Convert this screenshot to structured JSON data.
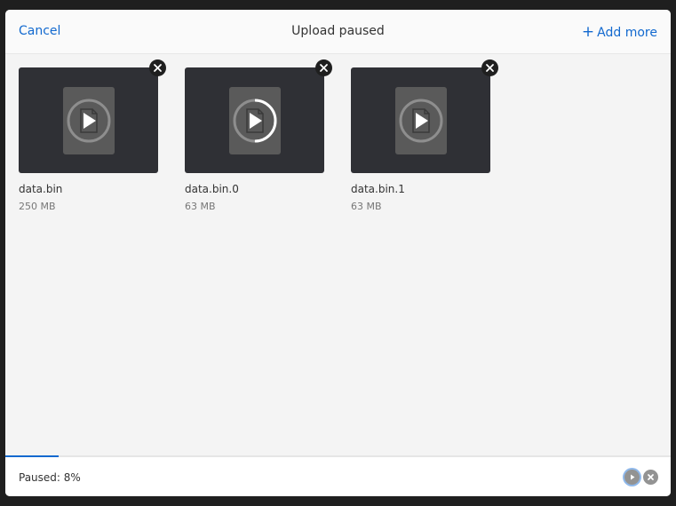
{
  "header": {
    "cancel_label": "Cancel",
    "title": "Upload paused",
    "add_more_icon": "plus-icon",
    "add_more_label": "Add more"
  },
  "files": [
    {
      "name": "data.bin",
      "size": "250 MB",
      "progress": 0
    },
    {
      "name": "data.bin.0",
      "size": "63 MB",
      "progress": 0.5
    },
    {
      "name": "data.bin.1",
      "size": "63 MB",
      "progress": 0
    }
  ],
  "footer": {
    "status": "Paused: 8%",
    "progress_percent": 8,
    "resume_icon": "play-icon",
    "cancel_icon": "close-icon"
  },
  "colors": {
    "accent": "#1269cf",
    "thumb_bg": "#2f3035"
  }
}
